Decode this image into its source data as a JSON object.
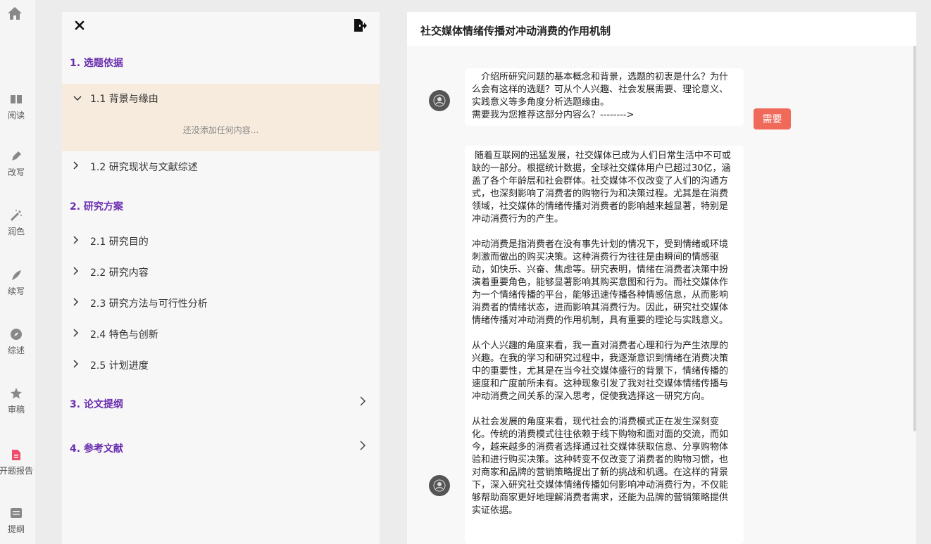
{
  "rail": {
    "home_icon": "home-icon",
    "items": [
      {
        "label": "阅读",
        "icon": "book-icon"
      },
      {
        "label": "改写",
        "icon": "pen-icon"
      },
      {
        "label": "润色",
        "icon": "magic-wand-icon"
      },
      {
        "label": "续写",
        "icon": "feather-icon"
      },
      {
        "label": "综述",
        "icon": "compass-icon"
      },
      {
        "label": "审稿",
        "icon": "star-icon"
      },
      {
        "label": "开题报告",
        "icon": "document-icon"
      },
      {
        "label": "提纲",
        "icon": "list-icon"
      }
    ],
    "active": "开题报告"
  },
  "outline": {
    "sections": [
      {
        "title": "1. 选题依据"
      },
      {
        "title": "2. 研究方案"
      },
      {
        "title": "3. 论文提纲"
      },
      {
        "title": "4. 参考文献"
      }
    ],
    "items": [
      {
        "label": "1.1 背景与缘由",
        "expanded": true
      },
      {
        "label": "1.2 研究现状与文献综述"
      },
      {
        "label": "2.1 研究目的"
      },
      {
        "label": "2.2 研究内容"
      },
      {
        "label": "2.3 研究方法与可行性分析"
      },
      {
        "label": "2.4 特色与创新"
      },
      {
        "label": "2.5 计划进度"
      }
    ],
    "empty_note": "还没添加任何内容..."
  },
  "content": {
    "title": "社交媒体情绪传播对冲动消费的作用机制",
    "prompt_lines": [
      "介绍所研究问题的基本概念和背景，选题的初衷是什么？为什么会有这样的选题？可从个人兴趣、社会发展需要、理论意义、实践意义等多角度分析选题缘由。",
      "需要我为您推荐这部分内容么？-------->"
    ],
    "need_button": "需要",
    "answer_paragraphs": [
      "随着互联网的迅猛发展，社交媒体已成为人们日常生活中不可或缺的一部分。根据统计数据，全球社交媒体用户已超过30亿，涵盖了各个年龄层和社会群体。社交媒体不仅改变了人们的沟通方式，也深刻影响了消费者的购物行为和决策过程。尤其是在消费领域，社交媒体的情绪传播对消费者的影响越来越显著，特别是冲动消费行为的产生。",
      "冲动消费是指消费者在没有事先计划的情况下，受到情绪或环境刺激而做出的购买决策。这种消费行为往往是由瞬间的情感驱动，如快乐、兴奋、焦虑等。研究表明，情绪在消费者决策中扮演着重要角色，能够显著影响其购买意图和行为。而社交媒体作为一个情绪传播的平台，能够迅速传播各种情感信息，从而影响消费者的情绪状态，进而影响其消费行为。因此，研究社交媒体情绪传播对冲动消费的作用机制，具有重要的理论与实践意义。",
      "从个人兴趣的角度来看，我一直对消费者心理和行为产生浓厚的兴趣。在我的学习和研究过程中，我逐渐意识到情绪在消费决策中的重要性，尤其是在当今社交媒体盛行的背景下，情绪传播的速度和广度前所未有。这种现象引发了我对社交媒体情绪传播与冲动消费之间关系的深入思考，促使我选择这一研究方向。",
      "从社会发展的角度来看，现代社会的消费模式正在发生深刻变化。传统的消费模式往往依赖于线下购物和面对面的交流，而如今，越来越多的消费者选择通过社交媒体获取信息、分享购物体验和进行购买决策。这种转变不仅改变了消费者的购物习惯，也对商家和品牌的营销策略提出了新的挑战和机遇。在这样的背景下，深入研究社交媒体情绪传播如何影响冲动消费行为，不仅能够帮助商家更好地理解消费者需求，还能为品牌的营销策略提供实证依据。"
    ]
  }
}
